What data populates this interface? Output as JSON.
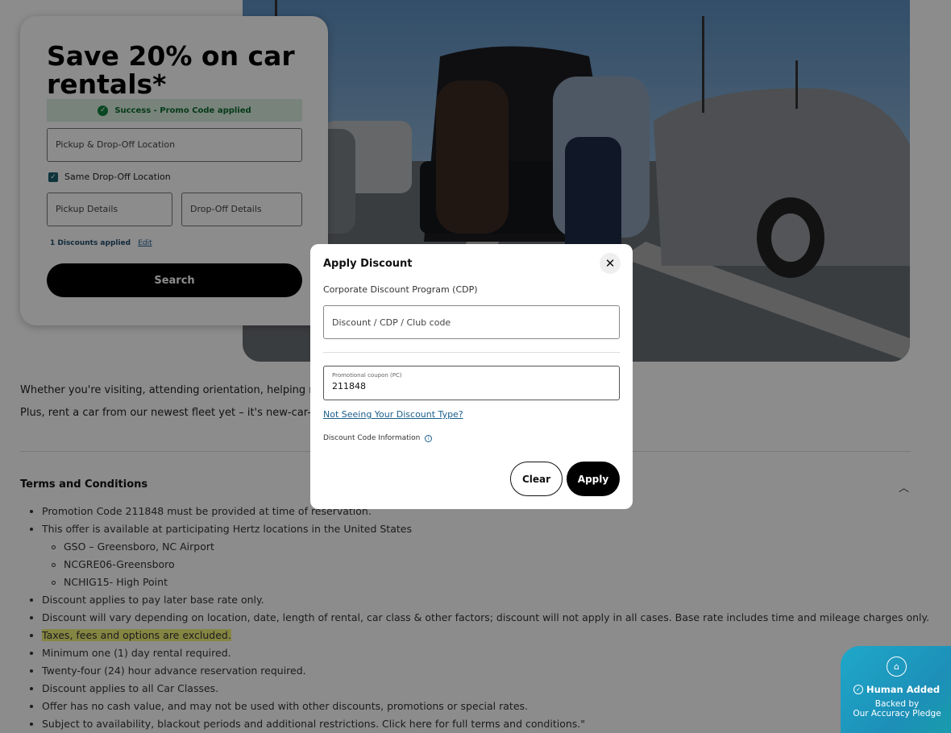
{
  "booking_card": {
    "title": "Save 20% on car rentals*",
    "success_message": "Success - Promo Code applied",
    "location_placeholder": "Pickup & Drop-Off Location",
    "same_dropoff_label": "Same Drop-Off Location",
    "same_dropoff_checked": true,
    "pickup_placeholder": "Pickup Details",
    "dropoff_placeholder": "Drop-Off Details",
    "discounts_applied": "1 Discounts applied",
    "edit_link": "Edit",
    "search_button": "Search"
  },
  "content": {
    "paragraph_1": "Whether you're visiting, attending orientation, helping move, or a",
    "paragraph_2": "Plus, rent a car from our newest fleet yet – it's new-car-smell seas"
  },
  "terms": {
    "title": "Terms and Conditions",
    "items": [
      "Promotion Code 211848 must be provided at time of reservation.",
      "This offer is available at participating Hertz locations in the United States",
      "GSO – Greensboro, NC Airport",
      "NCGRE06-Greensboro",
      "NCHIG15- High Point",
      "Discount applies to pay later base rate only.",
      "Discount will vary depending on location, date, length of rental, car class & other factors; discount will not apply in all cases. Base rate includes time and mileage charges only.",
      "Taxes, fees and options are excluded.",
      "Minimum one (1) day rental required.",
      "Twenty-four (24) hour advance reservation required.",
      "Discount applies to all Car Classes.",
      "Offer has no cash value, and may not be used with other discounts, promotions or special rates.",
      "Subject to availability, blackout periods and additional restrictions. Click here for full terms and conditions.\""
    ]
  },
  "modal": {
    "title": "Apply Discount",
    "close_icon": "close-icon",
    "cdp_label": "Corporate Discount Program (CDP)",
    "discount_placeholder": "Discount / CDP / Club code",
    "promo_label": "Promotional coupon (PC)",
    "promo_value": "211848",
    "not_seeing_link": "Not Seeing Your Discount Type?",
    "info_label": "Discount Code Information",
    "clear_button": "Clear",
    "apply_button": "Apply"
  },
  "badge": {
    "title": "Human Added",
    "subtitle_1": "Backed by",
    "subtitle_2": "Our Accuracy Pledge"
  },
  "colors": {
    "accent_dark": "#000000",
    "success_bg": "#dbeee0",
    "success_text": "#0b6b2f",
    "link": "#1a5e8a",
    "highlight": "#f3f27a",
    "badge": "#1ea8c9"
  }
}
